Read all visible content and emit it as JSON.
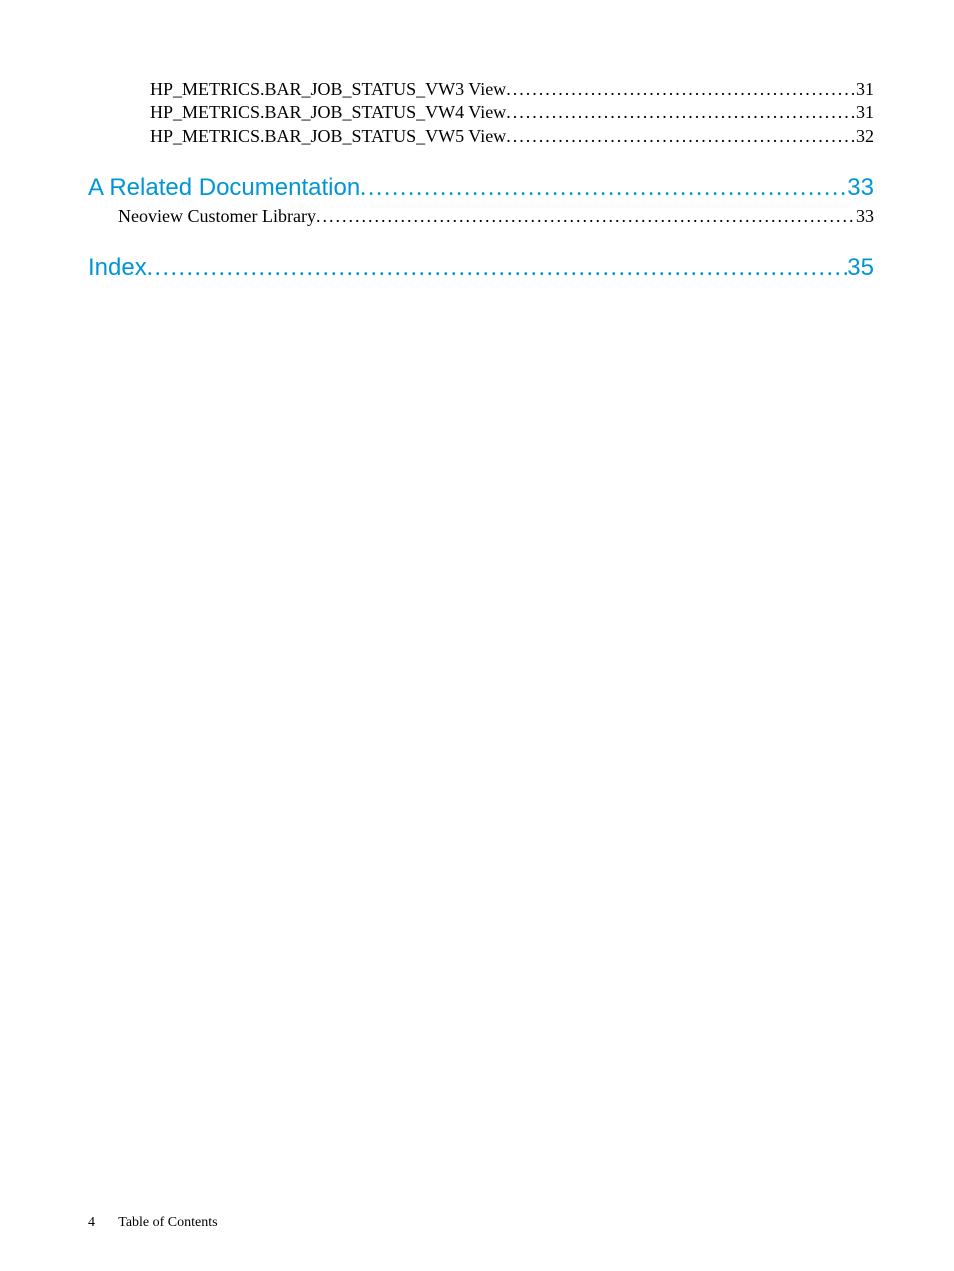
{
  "toc": {
    "entries": [
      {
        "label": "HP_METRICS.BAR_JOB_STATUS_VW3 View",
        "page": "31",
        "level": "sub"
      },
      {
        "label": "HP_METRICS.BAR_JOB_STATUS_VW4 View",
        "page": "31",
        "level": "sub"
      },
      {
        "label": "HP_METRICS.BAR_JOB_STATUS_VW5 View",
        "page": "32",
        "level": "sub"
      }
    ],
    "section1": {
      "heading": {
        "label": "A Related Documentation",
        "page": "33"
      },
      "sub": {
        "label": "Neoview Customer Library ",
        "page": "33"
      }
    },
    "section2": {
      "heading": {
        "label": "Index",
        "page": "35"
      }
    }
  },
  "footer": {
    "page_number": "4",
    "title": "Table of Contents"
  }
}
